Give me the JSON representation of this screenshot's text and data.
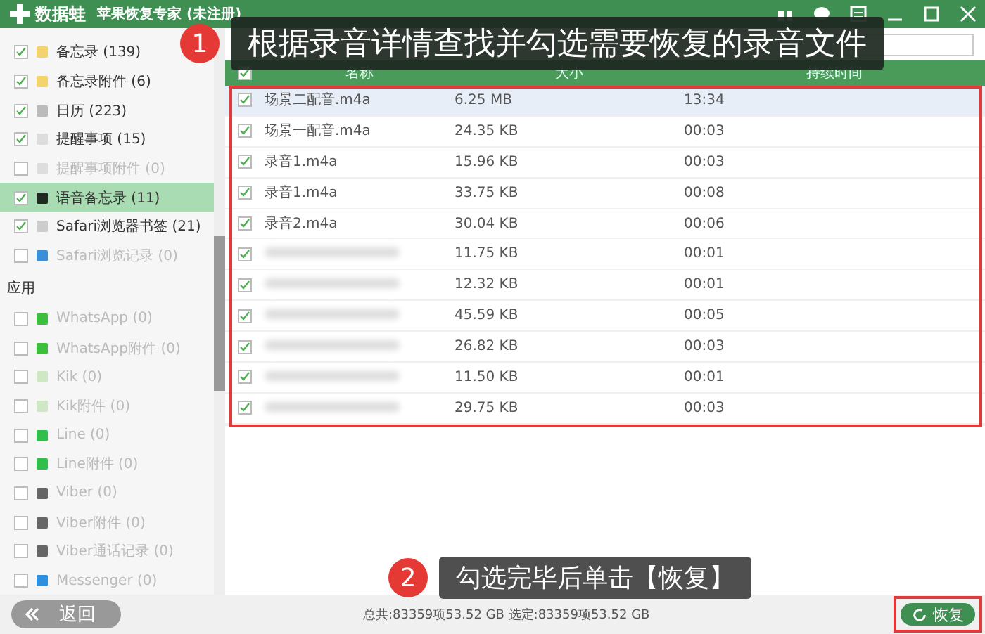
{
  "window": {
    "app_name": "数据蛙",
    "title": "苹果恢复专家 (未注册)"
  },
  "sidebar": {
    "sections": [
      {
        "items": [
          {
            "label": "备忘录 (139)",
            "kind": "notes",
            "checked": true,
            "disabled": false,
            "selected": false
          },
          {
            "label": "备忘录附件 (6)",
            "kind": "notes",
            "checked": true,
            "disabled": false,
            "selected": false
          },
          {
            "label": "日历 (223)",
            "kind": "calendar",
            "checked": true,
            "disabled": false,
            "selected": false
          },
          {
            "label": "提醒事项 (15)",
            "kind": "reminder",
            "checked": true,
            "disabled": false,
            "selected": false
          },
          {
            "label": "提醒事项附件 (0)",
            "kind": "reminder",
            "checked": false,
            "disabled": true,
            "selected": false
          },
          {
            "label": "语音备忘录 (11)",
            "kind": "voice",
            "checked": true,
            "disabled": false,
            "selected": true
          },
          {
            "label": "Safari浏览器书签 (21)",
            "kind": "bookmark",
            "checked": true,
            "disabled": false,
            "selected": false
          },
          {
            "label": "Safari浏览记录 (0)",
            "kind": "history",
            "checked": false,
            "disabled": true,
            "selected": false
          }
        ]
      },
      {
        "heading": "应用",
        "items": [
          {
            "label": "WhatsApp (0)",
            "kind": "whatsapp",
            "checked": false,
            "disabled": true,
            "selected": false
          },
          {
            "label": "WhatsApp附件 (0)",
            "kind": "whatsapp",
            "checked": false,
            "disabled": true,
            "selected": false
          },
          {
            "label": "Kik (0)",
            "kind": "kik",
            "checked": false,
            "disabled": true,
            "selected": false
          },
          {
            "label": "Kik附件 (0)",
            "kind": "kik",
            "checked": false,
            "disabled": true,
            "selected": false
          },
          {
            "label": "Line (0)",
            "kind": "line",
            "checked": false,
            "disabled": true,
            "selected": false
          },
          {
            "label": "Line附件 (0)",
            "kind": "line",
            "checked": false,
            "disabled": true,
            "selected": false
          },
          {
            "label": "Viber (0)",
            "kind": "viber",
            "checked": false,
            "disabled": true,
            "selected": false
          },
          {
            "label": "Viber附件 (0)",
            "kind": "viber",
            "checked": false,
            "disabled": true,
            "selected": false
          },
          {
            "label": "Viber通话记录 (0)",
            "kind": "viber",
            "checked": false,
            "disabled": true,
            "selected": false
          },
          {
            "label": "Messenger (0)",
            "kind": "messenger",
            "checked": false,
            "disabled": true,
            "selected": false
          }
        ]
      }
    ]
  },
  "table": {
    "all_checked": true,
    "columns": [
      "名称",
      "大小",
      "持续时间"
    ],
    "rows": [
      {
        "name": "场景二配音.m4a",
        "size": "6.25 MB",
        "duration": "13:34",
        "checked": true,
        "selected": true
      },
      {
        "name": "场景一配音.m4a",
        "size": "24.35 KB",
        "duration": "00:03",
        "checked": true,
        "selected": false
      },
      {
        "name": "录音1.m4a",
        "size": "15.96 KB",
        "duration": "00:03",
        "checked": true,
        "selected": false
      },
      {
        "name": "录音1.m4a",
        "size": "33.75 KB",
        "duration": "00:08",
        "checked": true,
        "selected": false
      },
      {
        "name": "录音2.m4a",
        "size": "30.04 KB",
        "duration": "00:06",
        "checked": true,
        "selected": false
      },
      {
        "size": "11.75 KB",
        "duration": "00:01",
        "checked": true,
        "selected": false
      },
      {
        "size": "12.32 KB",
        "duration": "00:01",
        "checked": true,
        "selected": false
      },
      {
        "size": "45.59 KB",
        "duration": "00:05",
        "checked": true,
        "selected": false
      },
      {
        "size": "26.82 KB",
        "duration": "00:03",
        "checked": true,
        "selected": false
      },
      {
        "size": "11.50 KB",
        "duration": "00:01",
        "checked": true,
        "selected": false
      },
      {
        "size": "29.75 KB",
        "duration": "00:03",
        "checked": true,
        "selected": false
      }
    ]
  },
  "bottom_bar": {
    "back_button": "返回",
    "status": "总共:83359项53.52 GB 选定:83359项53.52 GB",
    "recover_button": "恢复"
  },
  "callouts": [
    {
      "number": "1",
      "text": "根据录音详情查找并勾选需要恢复的录音文件"
    },
    {
      "number": "2",
      "text": "勾选完毕后单击【恢复】"
    }
  ]
}
